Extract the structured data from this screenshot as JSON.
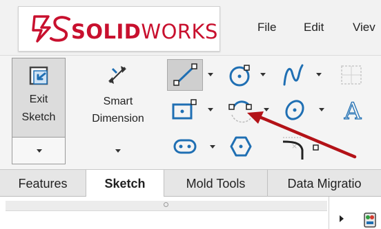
{
  "app": {
    "brand_prefix": "SOLID",
    "brand_suffix": "WORKS"
  },
  "menu": [
    "File",
    "Edit",
    "Viev"
  ],
  "ribbon": {
    "exit_sketch": {
      "line1": "Exit",
      "line2": "Sketch"
    },
    "smart_dimension": {
      "line1": "Smart",
      "line2": "Dimension"
    },
    "text_tool_glyph": "A"
  },
  "tabs": [
    {
      "label": "Features",
      "active": false
    },
    {
      "label": "Sketch",
      "active": true
    },
    {
      "label": "Mold Tools",
      "active": false
    },
    {
      "label": "Data Migratio",
      "active": false
    }
  ],
  "colors": {
    "brand_red": "#c8102e",
    "icon_blue": "#1f6fb3",
    "arrow_red": "#b31217"
  }
}
